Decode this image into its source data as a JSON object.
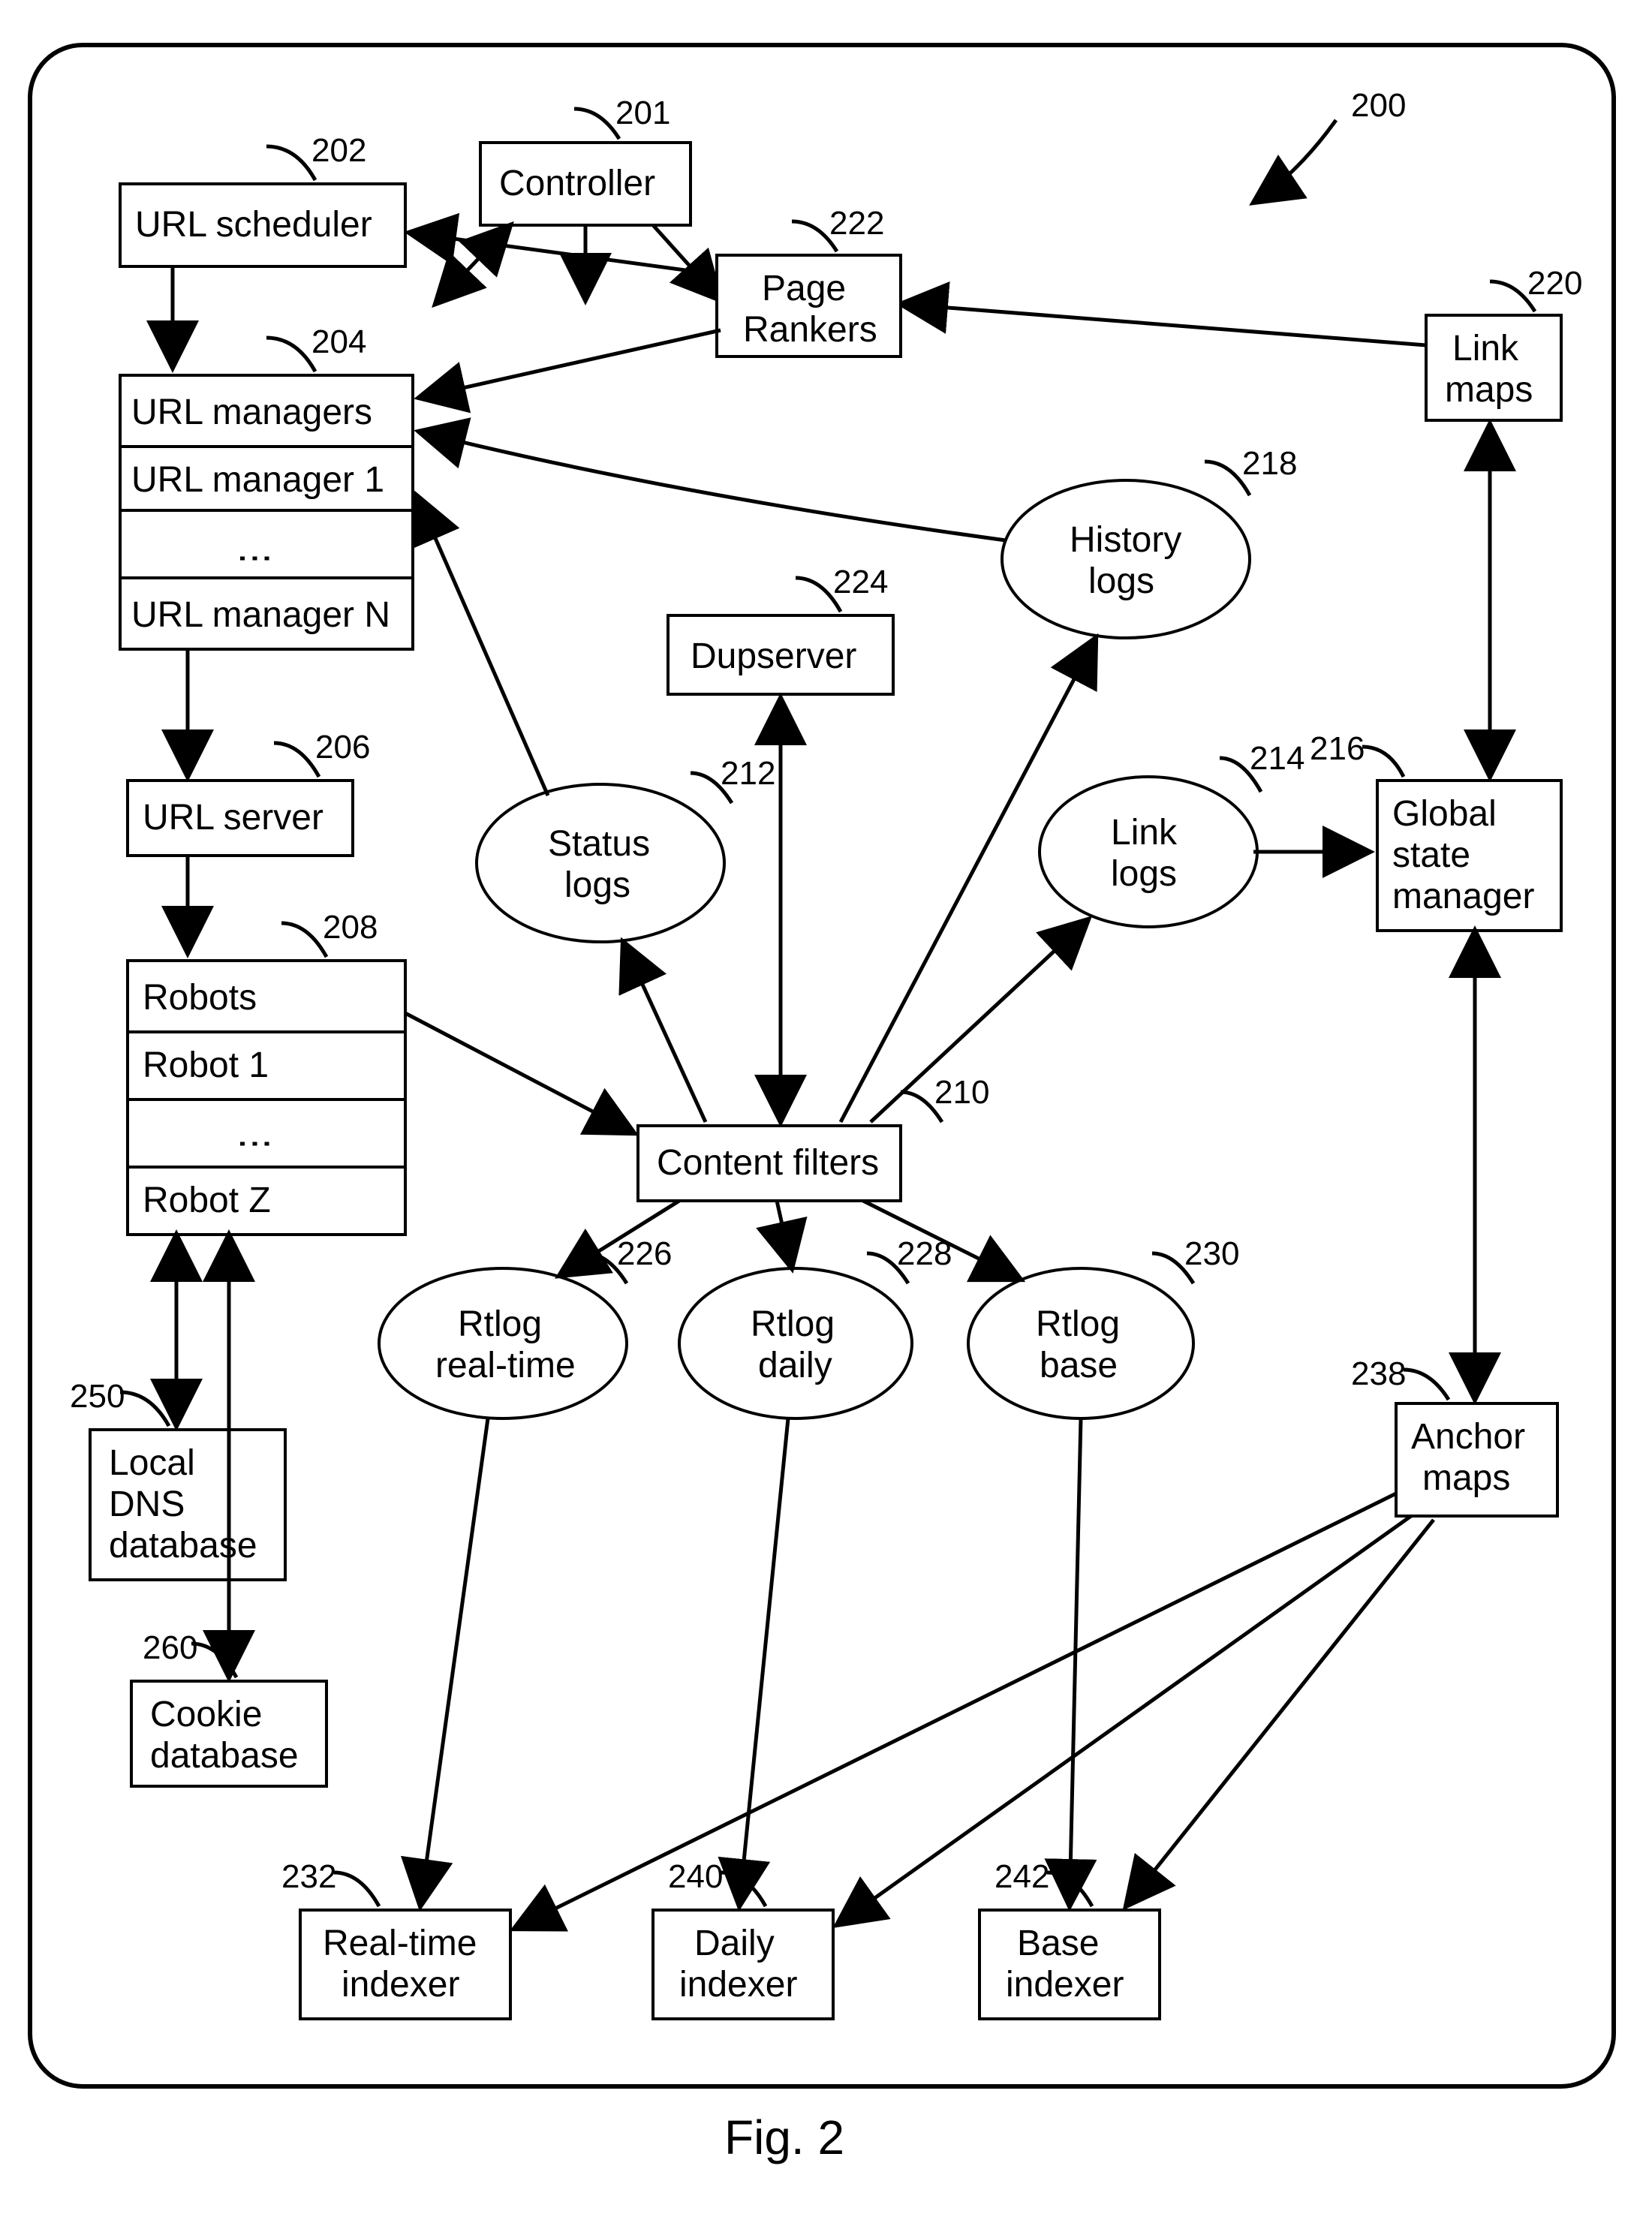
{
  "figure_caption": "Fig. 2",
  "diagram_ref": "200",
  "nodes": {
    "controller": {
      "label": "Controller",
      "ref": "201"
    },
    "url_scheduler": {
      "label": "URL scheduler",
      "ref": "202"
    },
    "url_managers": {
      "header": "URL managers",
      "row1": "URL manager 1",
      "rowN": "URL manager N",
      "ref": "204"
    },
    "url_server": {
      "label": "URL server",
      "ref": "206"
    },
    "robots": {
      "header": "Robots",
      "row1": "Robot 1",
      "rowN": "Robot Z",
      "ref": "208"
    },
    "content_filters": {
      "label": "Content filters",
      "ref": "210"
    },
    "status_logs": {
      "line1": "Status",
      "line2": "logs",
      "ref": "212"
    },
    "link_logs": {
      "line1": "Link",
      "line2": "logs",
      "ref": "214"
    },
    "global_state_manager": {
      "line1": "Global",
      "line2": "state",
      "line3": "manager",
      "ref": "216"
    },
    "history_logs": {
      "line1": "History",
      "line2": "logs",
      "ref": "218"
    },
    "link_maps": {
      "line1": "Link",
      "line2": "maps",
      "ref": "220"
    },
    "page_rankers": {
      "line1": "Page",
      "line2": "Rankers",
      "ref": "222"
    },
    "dupserver": {
      "label": "Dupserver",
      "ref": "224"
    },
    "rtlog_realtime": {
      "line1": "Rtlog",
      "line2": "real-time",
      "ref": "226"
    },
    "rtlog_daily": {
      "line1": "Rtlog",
      "line2": "daily",
      "ref": "228"
    },
    "rtlog_base": {
      "line1": "Rtlog",
      "line2": "base",
      "ref": "230"
    },
    "realtime_indexer": {
      "line1": "Real-time",
      "line2": "indexer",
      "ref": "232"
    },
    "anchor_maps": {
      "line1": "Anchor",
      "line2": "maps",
      "ref": "238"
    },
    "daily_indexer": {
      "line1": "Daily",
      "line2": "indexer",
      "ref": "240"
    },
    "base_indexer": {
      "line1": "Base",
      "line2": "indexer",
      "ref": "242"
    },
    "local_dns": {
      "line1": "Local",
      "line2": "DNS",
      "line3": "database",
      "ref": "250"
    },
    "cookie_db": {
      "line1": "Cookie",
      "line2": "database",
      "ref": "260"
    }
  }
}
